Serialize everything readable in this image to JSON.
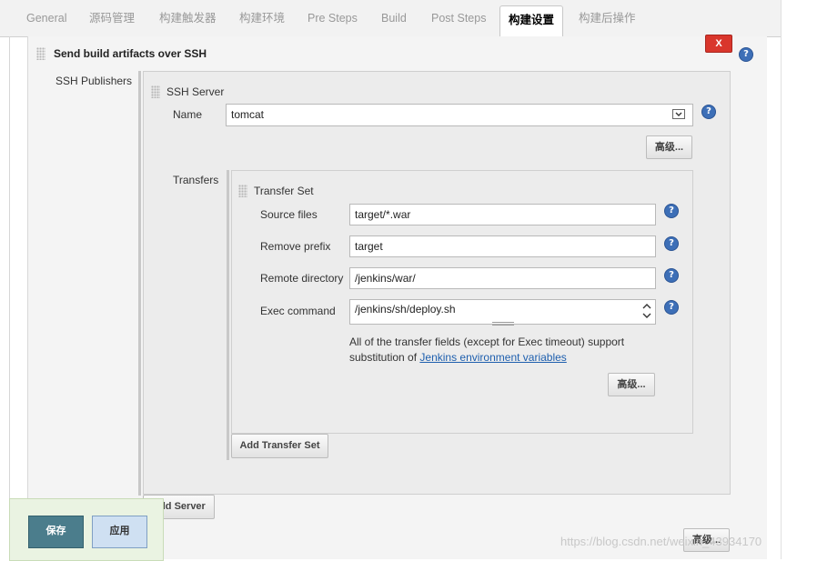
{
  "tabs": [
    {
      "label": "General",
      "active": false
    },
    {
      "label": "源码管理",
      "active": false
    },
    {
      "label": "构建触发器",
      "active": false
    },
    {
      "label": "构建环境",
      "active": false
    },
    {
      "label": "Pre Steps",
      "active": false
    },
    {
      "label": "Build",
      "active": false
    },
    {
      "label": "Post Steps",
      "active": false
    },
    {
      "label": "构建设置",
      "active": true
    },
    {
      "label": "构建后操作",
      "active": false
    }
  ],
  "section": {
    "title": "Send build artifacts over SSH",
    "delete_label": "X",
    "help_label": "?"
  },
  "publishers": {
    "label": "SSH Publishers",
    "server_title": "SSH Server",
    "name_label": "Name",
    "name_value": "tomcat",
    "advanced_label": "高级...",
    "transfers_label": "Transfers",
    "transfer_set": {
      "title": "Transfer Set",
      "source_files_label": "Source files",
      "source_files_value": "target/*.war",
      "remove_prefix_label": "Remove prefix",
      "remove_prefix_value": "target",
      "remote_directory_label": "Remote directory",
      "remote_directory_value": "/jenkins/war/",
      "exec_command_label": "Exec command",
      "exec_command_value": "/jenkins/sh/deploy.sh",
      "note_text": "All of the transfer fields (except for Exec timeout) support",
      "note_text2_prefix": "substitution of ",
      "note_link": "Jenkins environment variables",
      "advanced_label": "高级..."
    },
    "add_transfer_set_label": "Add Transfer Set",
    "add_server_label": "Add Server"
  },
  "footer": {
    "save_label": "保存",
    "apply_label": "应用",
    "advanced_label": "高级..."
  },
  "watermark": "https://blog.csdn.net/weixin_43934170",
  "colors": {
    "delete": "#d9362c",
    "help": "#3d6fb7",
    "save": "#4b7d8c",
    "apply": "#cfe0f2",
    "link": "#1e5fae"
  }
}
